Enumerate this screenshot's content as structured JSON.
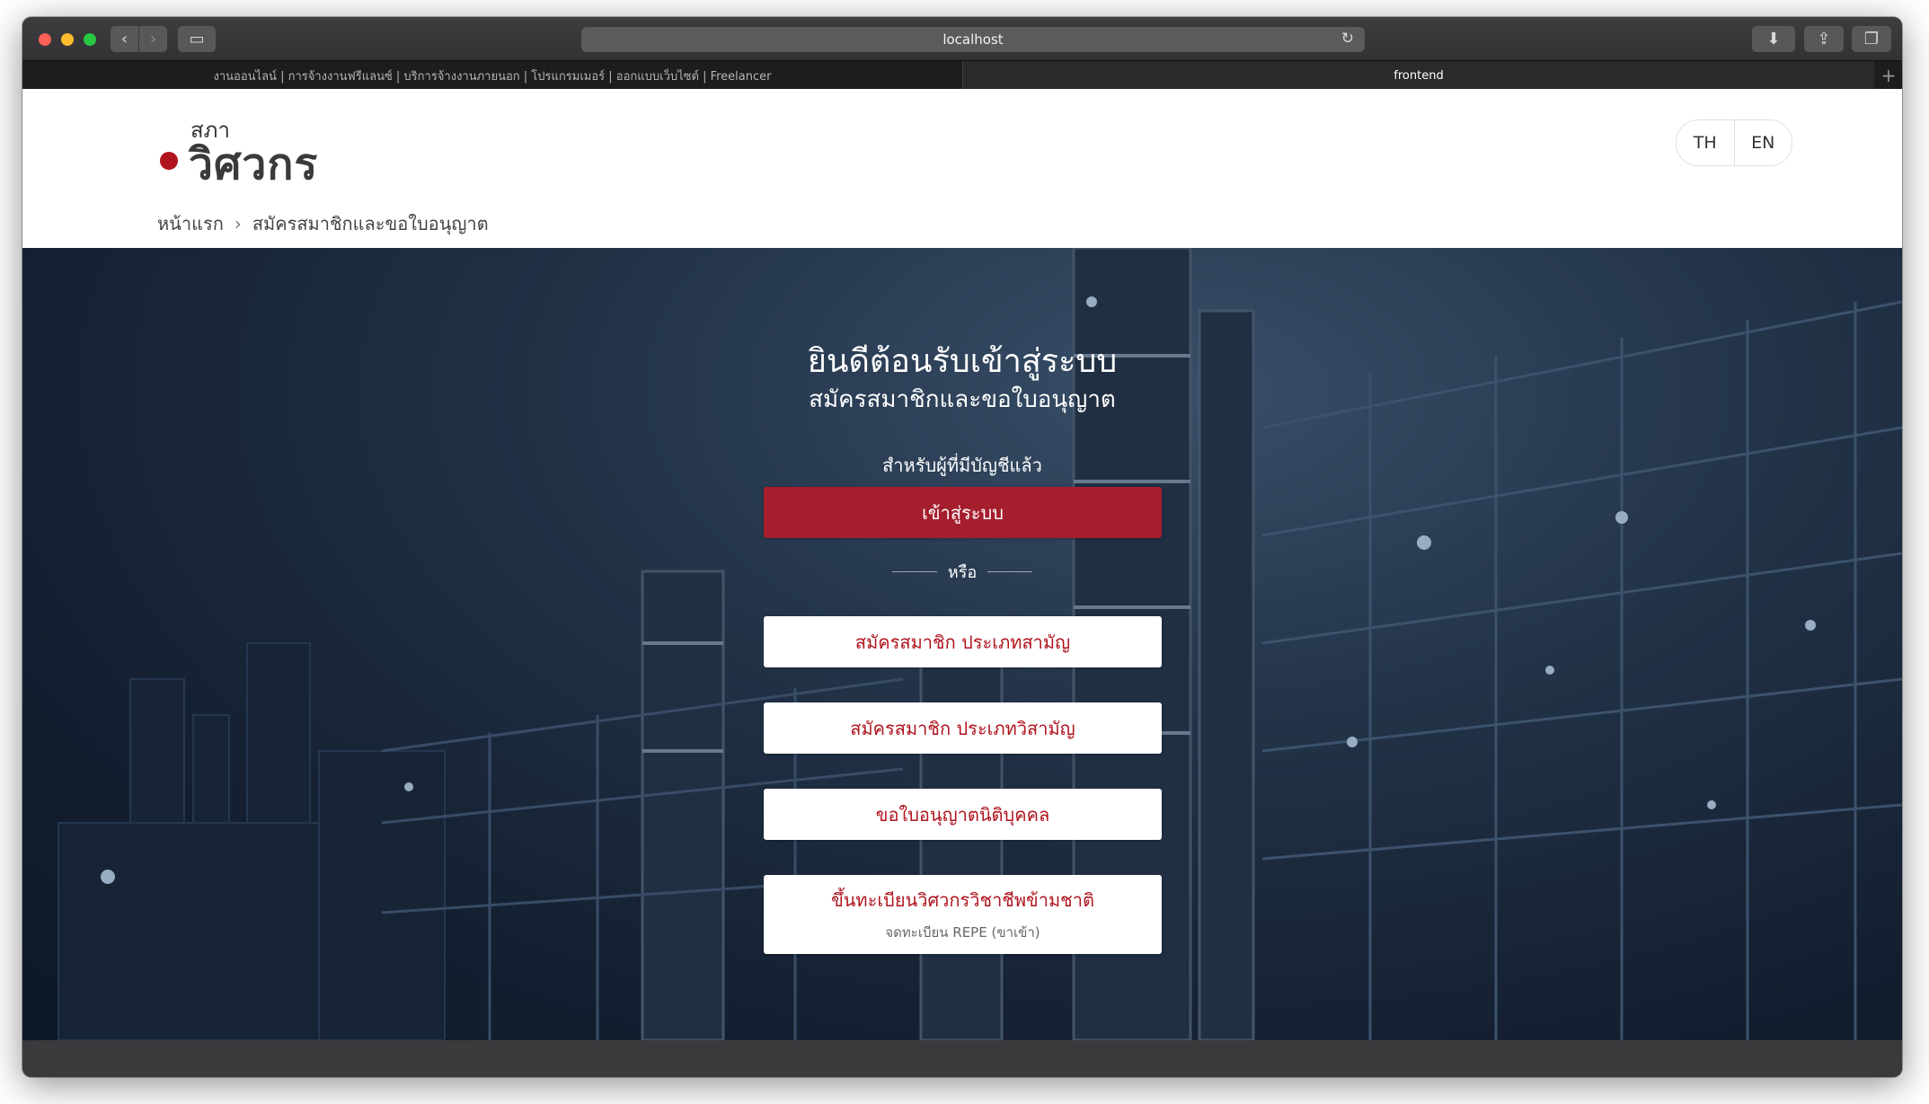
{
  "browser": {
    "address": "localhost",
    "tabs": [
      {
        "title": "งานออนไลน์ | การจ้างงานฟรีแลนซ์ | บริการจ้างงานภายนอก | โปรแกรมเมอร์ | ออกแบบเว็บไซต์ | Freelancer"
      },
      {
        "title": "frontend"
      }
    ],
    "new_tab": "+",
    "icons": {
      "back": "‹",
      "forward": "›",
      "sidebar": "▭",
      "reload": "↻",
      "download": "⬇",
      "share": "⇪",
      "tabs": "❐"
    }
  },
  "logo": {
    "small": "สภา",
    "main": "วิศวกร"
  },
  "language": {
    "th": "TH",
    "en": "EN"
  },
  "breadcrumb": {
    "home": "หน้าแรก",
    "separator": "›",
    "current": "สมัครสมาชิกและขอใบอนุญาต"
  },
  "hero": {
    "title": "ยินดีต้อนรับเข้าสู่ระบบ",
    "subtitle": "สมัครสมาชิกและขอใบอนุญาต",
    "existing_label": "สำหรับผู้ที่มีบัญชีแล้ว",
    "login_button": "เข้าสู่ระบบ",
    "or": "หรือ",
    "options": [
      {
        "label": "สมัครสมาชิก ประเภทสามัญ"
      },
      {
        "label": "สมัครสมาชิก ประเภทวิสามัญ"
      },
      {
        "label": "ขอใบอนุญาตนิติบุคคล"
      },
      {
        "label": "ขึ้นทะเบียนวิศวกรวิชาชีพข้ามชาติ",
        "sublabel": "จดทะเบียน REPE (ขาเข้า)"
      }
    ]
  },
  "colors": {
    "brand_red": "#b0141e",
    "login_button": "#a41e2d",
    "hero_dark": "#172335"
  }
}
